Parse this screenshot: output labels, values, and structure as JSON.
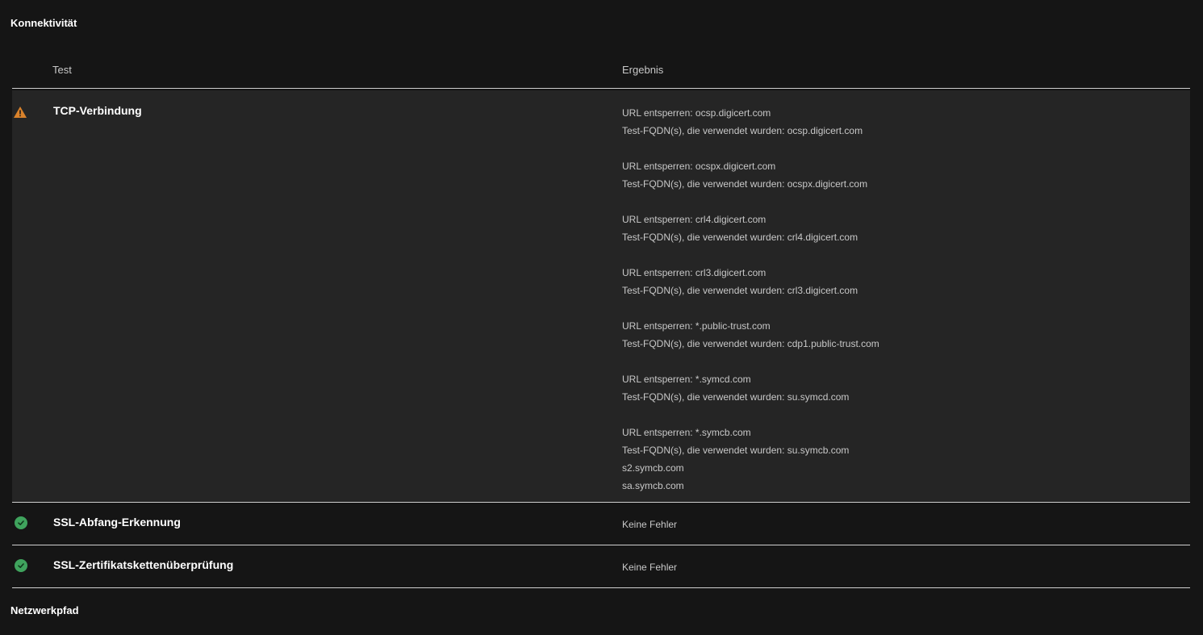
{
  "sections": {
    "connectivity_title": "Konnektivität",
    "network_path_title": "Netzwerkpfad"
  },
  "table": {
    "headers": {
      "test": "Test",
      "result": "Ergebnis"
    },
    "rows": [
      {
        "status": "warning",
        "icon": "warning-icon",
        "name": "TCP-Verbindung",
        "groups": [
          {
            "lines": [
              "URL entsperren: ocsp.digicert.com",
              "Test-FQDN(s), die verwendet wurden: ocsp.digicert.com"
            ]
          },
          {
            "lines": [
              "URL entsperren: ocspx.digicert.com",
              "Test-FQDN(s), die verwendet wurden: ocspx.digicert.com"
            ]
          },
          {
            "lines": [
              "URL entsperren: crl4.digicert.com",
              "Test-FQDN(s), die verwendet wurden: crl4.digicert.com"
            ]
          },
          {
            "lines": [
              "URL entsperren: crl3.digicert.com",
              "Test-FQDN(s), die verwendet wurden: crl3.digicert.com"
            ]
          },
          {
            "lines": [
              "URL entsperren: *.public-trust.com",
              "Test-FQDN(s), die verwendet wurden: cdp1.public-trust.com"
            ]
          },
          {
            "lines": [
              "URL entsperren: *.symcd.com",
              "Test-FQDN(s), die verwendet wurden: su.symcd.com"
            ]
          },
          {
            "lines": [
              "URL entsperren: *.symcb.com",
              "Test-FQDN(s), die verwendet wurden: su.symcb.com",
              "s2.symcb.com",
              "sa.symcb.com"
            ]
          }
        ]
      },
      {
        "status": "success",
        "icon": "check-circle-icon",
        "name": "SSL-Abfang-Erkennung",
        "result": "Keine Fehler"
      },
      {
        "status": "success",
        "icon": "check-circle-icon",
        "name": "SSL-Zertifikatskettenüberprüfung",
        "result": "Keine Fehler"
      }
    ]
  },
  "colors": {
    "background": "#151515",
    "row_highlight": "#252525",
    "warning": "#d9822b",
    "success": "#3fa35d"
  }
}
